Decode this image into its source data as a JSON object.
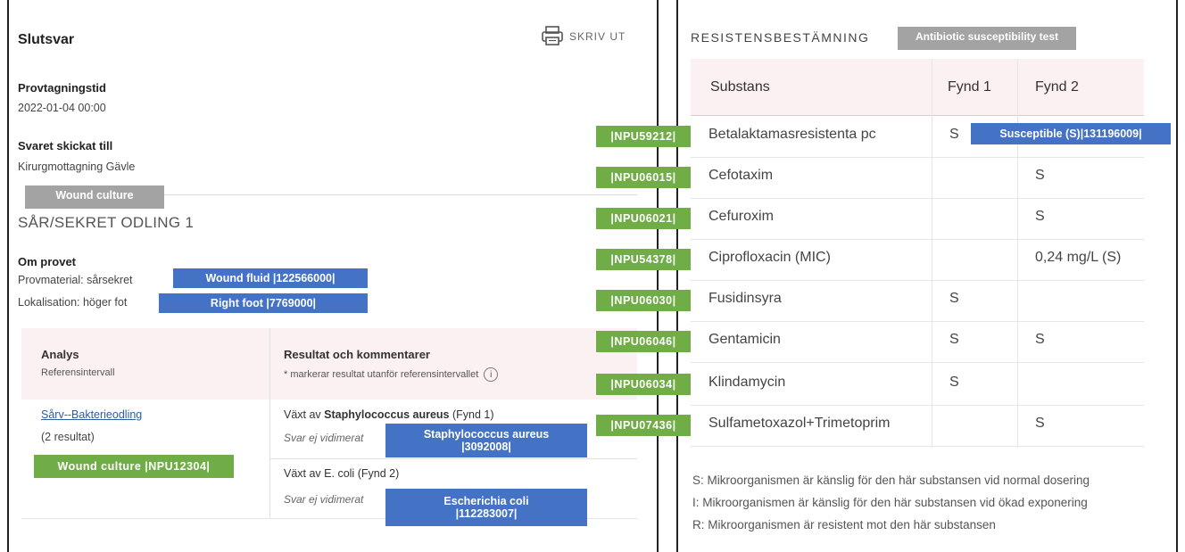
{
  "left": {
    "title": "Slutsvar",
    "print_label": "SKRIV UT",
    "sampling_time_label": "Provtagningstid",
    "sampling_time_value": "2022-01-04 00:00",
    "sent_to_label": "Svaret skickat till",
    "sent_to_value": "Kirurgmottagning Gävle",
    "culture_tag": "Wound culture",
    "culture_title": "SÅR/SEKRET ODLING 1",
    "about_label": "Om provet",
    "material_label": "Provmaterial: sårsekret",
    "material_tag": "Wound fluid |122566000|",
    "location_label": "Lokalisation: höger fot",
    "location_tag": "Right foot |7769000|",
    "table": {
      "col1_header": "Analys",
      "col1_sub": "Referensintervall",
      "col2_header": "Resultat och kommentarer",
      "col2_sub": "* markerar resultat utanför referensintervallet",
      "info_icon": "i",
      "analysis_link": "Sårv--Bakterieodling",
      "analysis_count": "(2 resultat)",
      "analysis_tag": "Wound culture |NPU12304|",
      "finding1_prefix": "Växt av",
      "finding1_org": "Staphylococcus aureus",
      "finding1_suffix": "(Fynd 1)",
      "finding1_status": "Svar ej vidimerat",
      "finding1_tag_line1": "Staphylococcus aureus",
      "finding1_tag_line2": "|3092008|",
      "finding2_prefix": "Växt av E. coli",
      "finding2_suffix": "(Fynd 2)",
      "finding2_status": "Svar ej vidimerat",
      "finding2_tag_line1": "Escherichia coli",
      "finding2_tag_line2": "|112283007|"
    }
  },
  "right": {
    "title": "RESISTENSBESTÄMNING",
    "title_tag": "Antibiotic susceptibility test",
    "headers": [
      "Substans",
      "Fynd 1",
      "Fynd 2"
    ],
    "rows": [
      {
        "code": "|NPU59212|",
        "substance": "Betalaktamasresistenta pc",
        "f1": "S",
        "f2": ""
      },
      {
        "code": "|NPU06015|",
        "substance": "Cefotaxim",
        "f1": "",
        "f2": "S"
      },
      {
        "code": "|NPU06021|",
        "substance": "Cefuroxim",
        "f1": "",
        "f2": "S"
      },
      {
        "code": "|NPU54378|",
        "substance": "Ciprofloxacin (MIC)",
        "f1": "",
        "f2": "0,24 mg/L (S)"
      },
      {
        "code": "|NPU06030|",
        "substance": "Fusidinsyra",
        "f1": "S",
        "f2": ""
      },
      {
        "code": "|NPU06046|",
        "substance": "Gentamicin",
        "f1": "S",
        "f2": "S"
      },
      {
        "code": "|NPU06034|",
        "substance": "Klindamycin",
        "f1": "S",
        "f2": ""
      },
      {
        "code": "|NPU07436|",
        "substance": "Sulfametoxazol+Trimetoprim",
        "f1": "",
        "f2": "S"
      }
    ],
    "susceptible_tag": "Susceptible (S)|131196009|",
    "legend": [
      "S: Mikroorganismen är känslig för den här substansen vid normal dosering",
      "I:  Mikroorganismen är känslig för den här substansen vid ökad exponering",
      "R: Mikroorganismen är resistent mot den här substansen"
    ]
  },
  "colors": {
    "blue_tag": "#4472c4",
    "green_tag": "#70ad47",
    "gray_tag": "#a3a3a3",
    "header_pink": "#fcf1f2"
  }
}
